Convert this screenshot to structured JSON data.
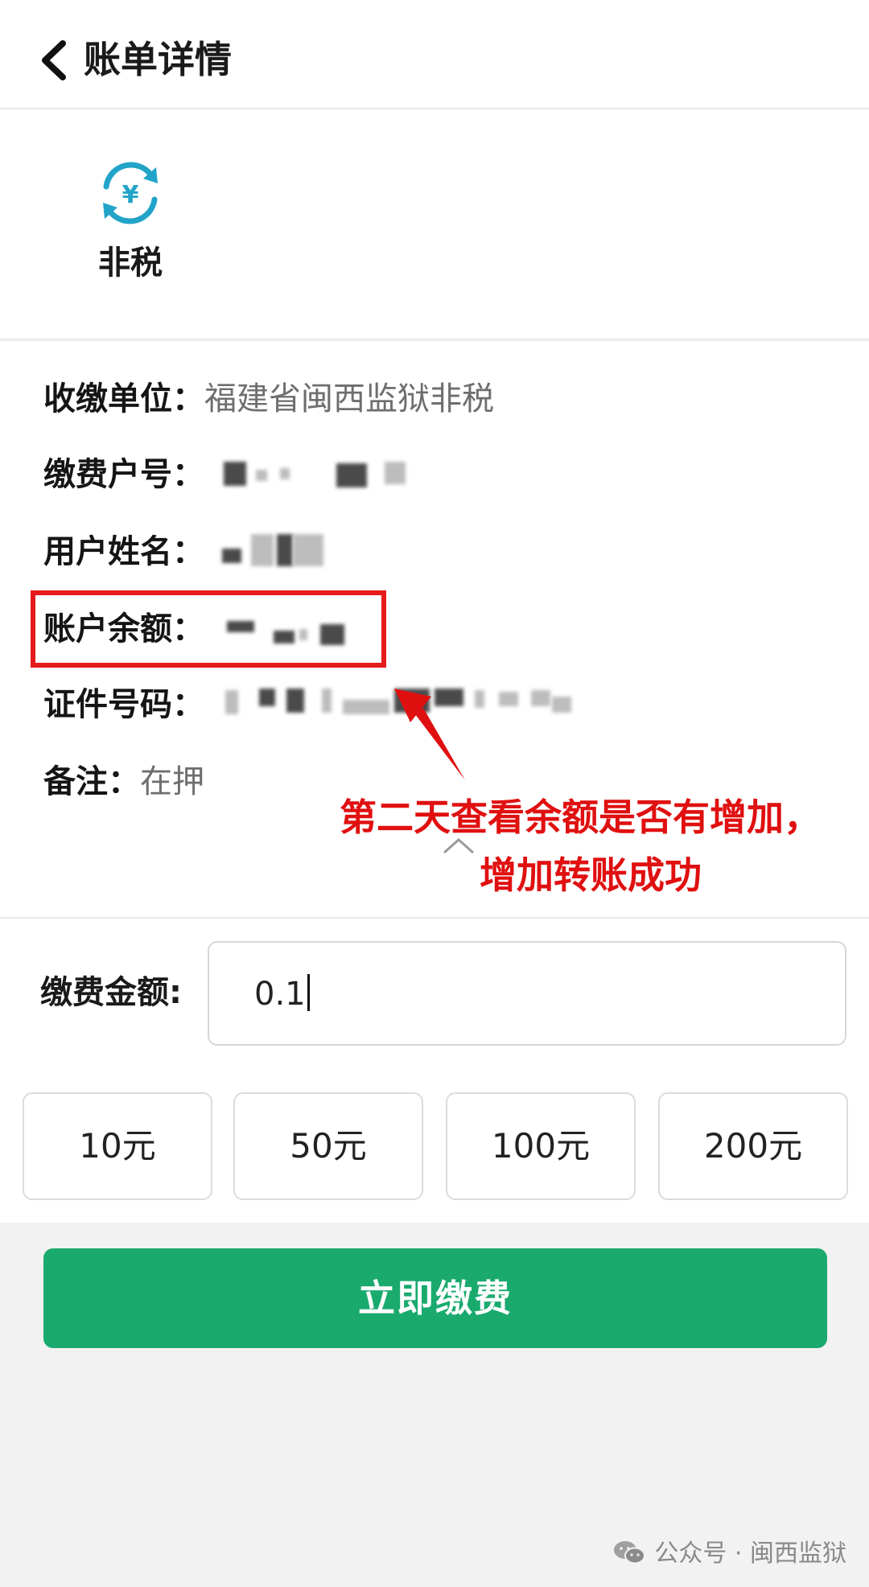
{
  "header": {
    "title": "账单详情"
  },
  "bill_type": {
    "label": "非税"
  },
  "info": {
    "unit_label": "收缴单位：",
    "unit_value": "福建省闽西监狱非税",
    "account_no_label": "缴费户号：",
    "user_name_label": "用户姓名：",
    "balance_label": "账户余额：",
    "id_number_label": "证件号码：",
    "remark_label": "备注：",
    "remark_value": "在押"
  },
  "annotation": {
    "line1": "第二天查看余额是否有增加，",
    "line2": "增加转账成功",
    "color": "#e01010"
  },
  "payment": {
    "amount_label": "缴费金额:",
    "amount_value": "0.1",
    "quick_amounts": [
      "10元",
      "50元",
      "100元",
      "200元"
    ],
    "submit_label": "立即缴费",
    "accent": "#1aaa6e"
  },
  "watermark": {
    "text": "公众号 · 闽西监狱"
  }
}
